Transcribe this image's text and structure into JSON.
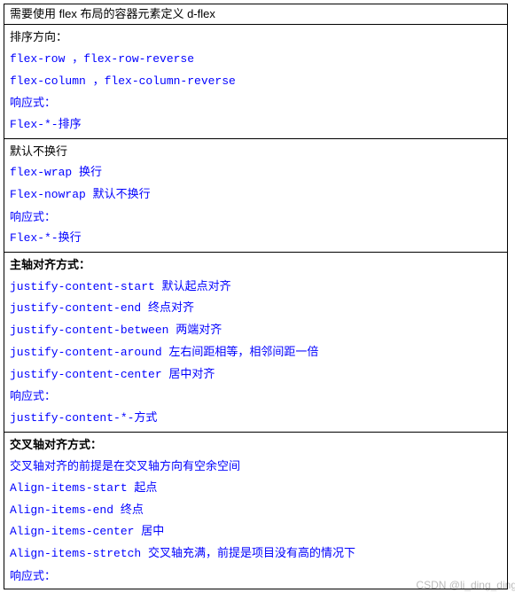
{
  "header": "需要使用 flex 布局的容器元素定义 d-flex",
  "sections": [
    {
      "title": "排序方向：",
      "bold": false,
      "lines": [
        "flex-row  ，flex-row-reverse",
        "flex-column ，flex-column-reverse",
        "响应式：",
        "Flex-*-排序"
      ]
    },
    {
      "title": "默认不换行",
      "bold": false,
      "lines": [
        "flex-wrap 换行",
        "Flex-nowrap 默认不换行",
        "响应式：",
        "Flex-*-换行"
      ]
    },
    {
      "title": "主轴对齐方式：",
      "bold": true,
      "lines": [
        "justify-content-start   默认起点对齐",
        "justify-content-end    终点对齐",
        "justify-content-between  两端对齐",
        "justify-content-around   左右间距相等，相邻间距一倍",
        "justify-content-center   居中对齐",
        "响应式：",
        "justify-content-*-方式"
      ]
    },
    {
      "title": "交叉轴对齐方式：",
      "bold": true,
      "lines": [
        "交叉轴对齐的前提是在交叉轴方向有空余空间",
        "Align-items-start   起点",
        "Align-items-end    终点",
        "Align-items-center   居中",
        "Align-items-stretch   交叉轴充满，前提是项目没有高的情况下",
        "响应式："
      ]
    }
  ],
  "watermark": "CSDN @li_ding_ding"
}
